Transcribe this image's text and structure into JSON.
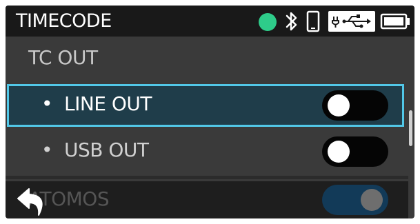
{
  "header": {
    "title": "TIMECODE",
    "status_color": "#2ecc8a",
    "icons": [
      "bluetooth-icon",
      "phone-icon",
      "usb-power-icon",
      "battery-icon"
    ]
  },
  "section": {
    "title": "TC OUT"
  },
  "rows": [
    {
      "label": "LINE OUT",
      "bullet": "•",
      "state": "off",
      "selected": true
    },
    {
      "label": "USB OUT",
      "bullet": "•",
      "state": "off",
      "selected": false
    }
  ],
  "dimmed_row": {
    "label": "ATOMOS",
    "state": "on"
  },
  "colors": {
    "accent": "#52c8e8",
    "selected_bg": "#1f3d4a",
    "toggle_on": "#1a4a6e"
  }
}
